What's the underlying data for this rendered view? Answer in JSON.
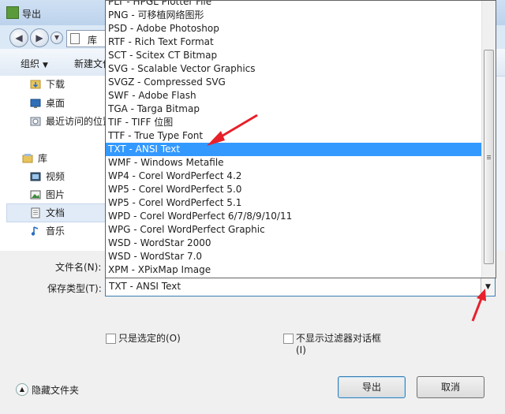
{
  "window": {
    "title": "导出"
  },
  "address": {
    "text": "库"
  },
  "toolbar": {
    "organize_label": "组织",
    "new_folder_label": "新建文件"
  },
  "sidebar": {
    "items": [
      {
        "label": "下载",
        "icon": "download-folder-icon"
      },
      {
        "label": "桌面",
        "icon": "desktop-icon"
      },
      {
        "label": "最近访问的位置",
        "icon": "recent-places-icon"
      },
      {
        "label": "库",
        "icon": "library-icon"
      },
      {
        "label": "视频",
        "icon": "video-library-icon"
      },
      {
        "label": "图片",
        "icon": "pictures-library-icon"
      },
      {
        "label": "文档",
        "icon": "documents-library-icon"
      },
      {
        "label": "音乐",
        "icon": "music-library-icon"
      }
    ]
  },
  "form": {
    "filename_label": "文件名(N):",
    "filetype_label": "保存类型(T):",
    "filetype_value": "TXT - ANSI Text",
    "only_selected_label": "只是选定的(O)",
    "no_filter_dialog_label": "不显示过滤器对话框",
    "no_filter_dialog_hotkey": "(I)",
    "hide_folders_label": "隐藏文件夹"
  },
  "buttons": {
    "export_label": "导出",
    "cancel_label": "取消"
  },
  "dropdown": {
    "options": [
      "PLT - HPGL Plotter File",
      "PNG - 可移植网络图形",
      "PSD - Adobe Photoshop",
      "RTF - Rich Text Format",
      "SCT - Scitex CT Bitmap",
      "SVG - Scalable Vector Graphics",
      "SVGZ - Compressed SVG",
      "SWF - Adobe Flash",
      "TGA - Targa Bitmap",
      "TIF - TIFF 位图",
      "TTF - True Type Font",
      "TXT - ANSI Text",
      "WMF - Windows Metafile",
      "WP4 - Corel WordPerfect 4.2",
      "WP5 - Corel WordPerfect 5.0",
      "WP5 - Corel WordPerfect 5.1",
      "WPD - Corel WordPerfect 6/7/8/9/10/11",
      "WPG - Corel WordPerfect Graphic",
      "WSD - WordStar 2000",
      "WSD - WordStar 7.0",
      "XPM - XPixMap Image"
    ],
    "selected": "TXT - ANSI Text"
  },
  "colors": {
    "selection": "#3399ff",
    "annotation_arrow": "#e8202a"
  }
}
